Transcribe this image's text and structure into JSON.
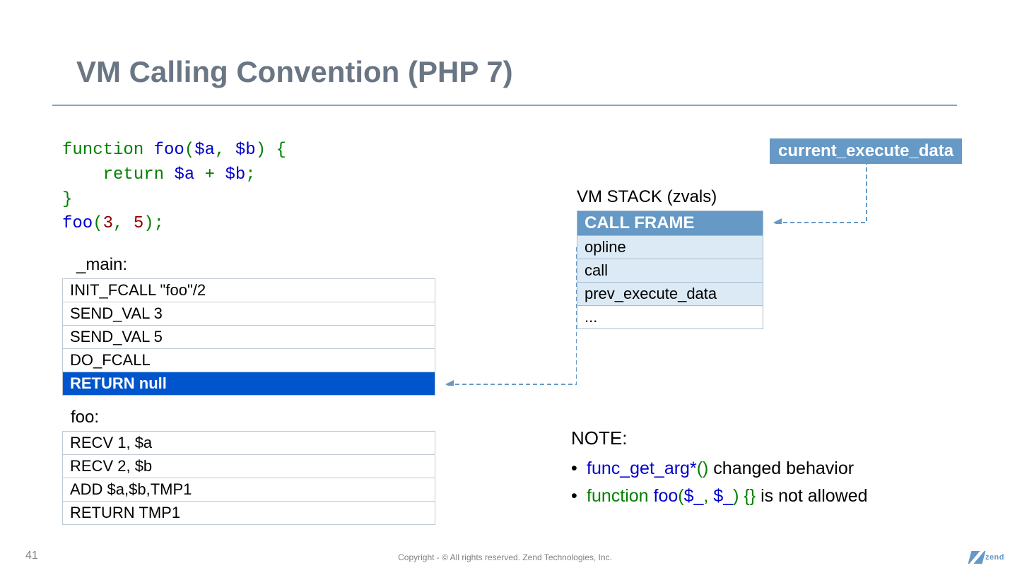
{
  "title": "VM Calling Convention (PHP 7)",
  "code": {
    "l1a": "function ",
    "l1b": "foo",
    "l1c": "(",
    "l1d": "$a",
    "l1e": ", ",
    "l1f": "$b",
    "l1g": ") {",
    "l2a": "    return ",
    "l2b": "$a",
    "l2c": " + ",
    "l2d": "$b",
    "l2e": ";",
    "l3": "}",
    "l4a": "foo",
    "l4b": "(",
    "l4c": "3",
    "l4d": ", ",
    "l4e": "5",
    "l4f": ");"
  },
  "main_label": "_main:",
  "main_rows": [
    "INIT_FCALL  \"foo\"/2",
    "SEND_VAL 3",
    "SEND_VAL 5",
    "DO_FCALL",
    "RETURN null"
  ],
  "foo_label": "foo:",
  "foo_rows": [
    "RECV 1, $a",
    "RECV 2, $b",
    "ADD $a,$b,TMP1",
    "RETURN TMP1"
  ],
  "current_exec": "current_execute_data",
  "vm_stack_label": "VM STACK (zvals)",
  "vm_header": "CALL FRAME",
  "vm_rows": [
    "opline",
    "call",
    "prev_execute_data",
    "..."
  ],
  "note": {
    "title": "NOTE:",
    "b1": {
      "c1": "func_get_arg*",
      "c2": "()",
      "rest": " changed behavior"
    },
    "b2": {
      "c1": "function ",
      "c2": "foo",
      "c3": "(",
      "c4": "$_",
      "c5": ", ",
      "c6": "$_",
      "c7": ") {}",
      "rest": " is not allowed"
    }
  },
  "footer": "Copyright - © All rights reserved. Zend Technologies, Inc.",
  "page_num": "41",
  "logo_text": "zend"
}
